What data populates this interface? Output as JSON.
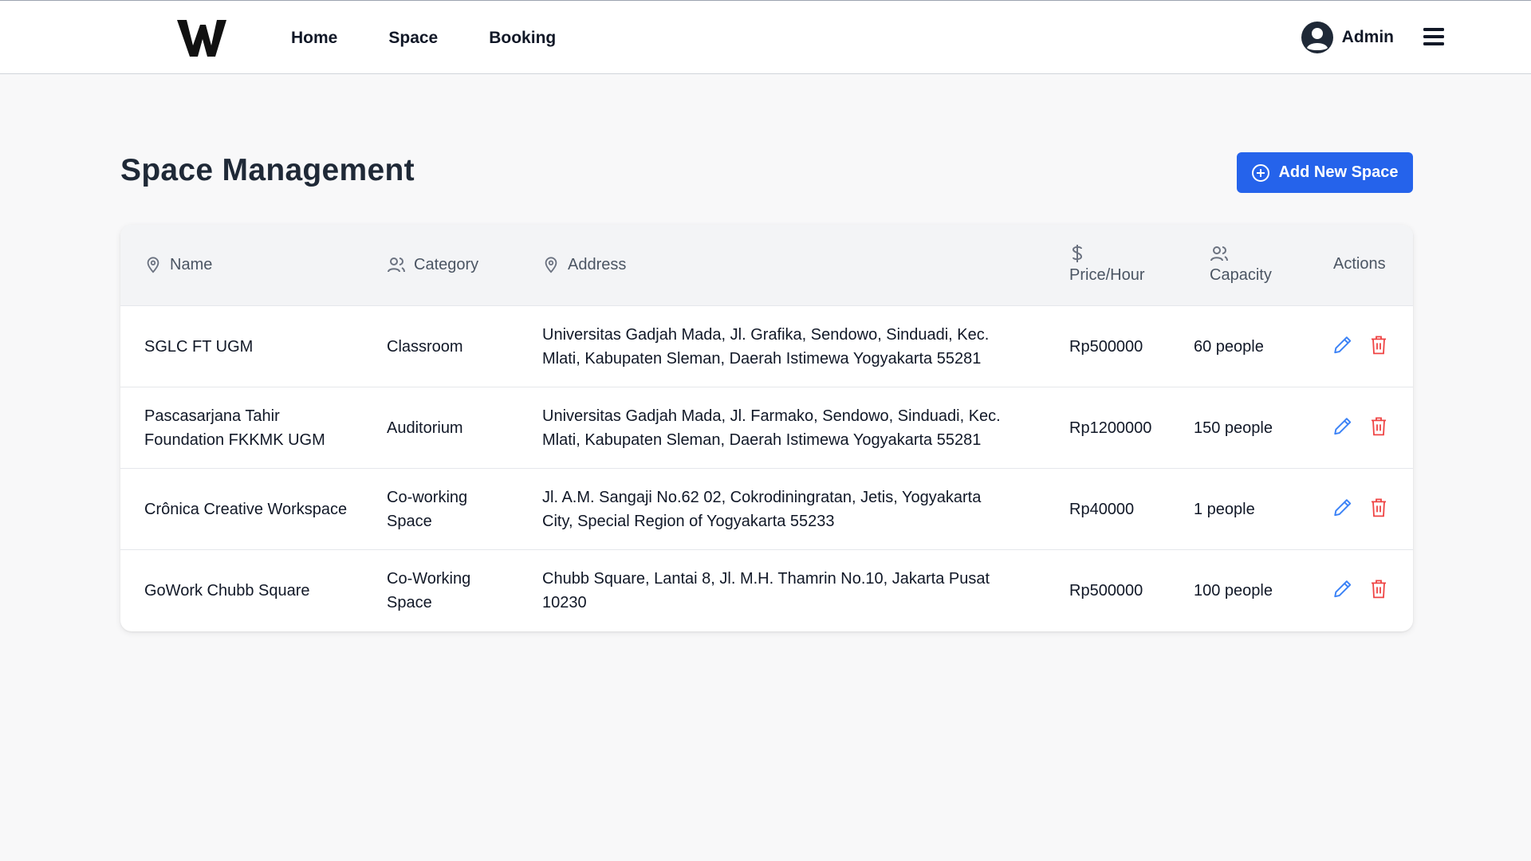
{
  "nav": {
    "links": [
      "Home",
      "Space",
      "Booking"
    ],
    "user_name": "Admin",
    "icons": {
      "logo": "w-logo",
      "avatar": "user-circle-icon",
      "menu": "hamburger-menu-icon"
    }
  },
  "page": {
    "title": "Space Management",
    "add_button_label": "Add New Space"
  },
  "table": {
    "headers": {
      "name": "Name",
      "category": "Category",
      "address": "Address",
      "price": "Price/Hour",
      "capacity": "Capacity",
      "actions": "Actions"
    },
    "rows": [
      {
        "name": "SGLC FT UGM",
        "category": "Classroom",
        "address": "Universitas Gadjah Mada, Jl. Grafika, Sendowo, Sinduadi, Kec. Mlati, Kabupaten Sleman, Daerah Istimewa Yogyakarta 55281",
        "price": "Rp500000",
        "capacity": "60 people"
      },
      {
        "name": "Pascasarjana Tahir Foundation FKKMK UGM",
        "category": "Auditorium",
        "address": "Universitas Gadjah Mada, Jl. Farmako, Sendowo, Sinduadi, Kec. Mlati, Kabupaten Sleman, Daerah Istimewa Yogyakarta 55281",
        "price": "Rp1200000",
        "capacity": "150 people"
      },
      {
        "name": "Crônica Creative Workspace",
        "category": "Co-working Space",
        "address": "Jl. A.M. Sangaji No.62 02, Cokrodiningratan, Jetis, Yogyakarta City, Special Region of Yogyakarta 55233",
        "price": "Rp40000",
        "capacity": "1 people"
      },
      {
        "name": "GoWork Chubb Square",
        "category": "Co-Working Space",
        "address": "Chubb Square, Lantai 8, Jl. M.H. Thamrin No.10, Jakarta Pusat 10230",
        "price": "Rp500000",
        "capacity": "100 people"
      }
    ]
  },
  "colors": {
    "primary": "#2563eb",
    "edit_icon": "#3b82f6",
    "delete_icon": "#ef4444",
    "page_bg": "#f8f8f9",
    "header_bg": "#f3f4f6"
  }
}
